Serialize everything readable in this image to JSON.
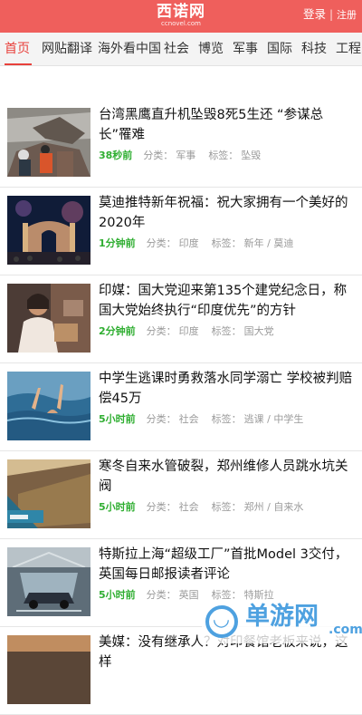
{
  "header": {
    "logo_main": "西诺网",
    "logo_sub": "ccnovel.com",
    "login": "登录",
    "separator": "|",
    "register": "注册"
  },
  "tabs": [
    {
      "label": "首页",
      "active": true
    },
    {
      "label": "网贴翻译",
      "active": false
    },
    {
      "label": "海外看中国",
      "active": false
    },
    {
      "label": "社会",
      "active": false
    },
    {
      "label": "博览",
      "active": false
    },
    {
      "label": "军事",
      "active": false
    },
    {
      "label": "国际",
      "active": false
    },
    {
      "label": "科技",
      "active": false
    },
    {
      "label": "工程",
      "active": false
    }
  ],
  "meta_labels": {
    "category": "分类：",
    "tags": "标签："
  },
  "articles": [
    {
      "title": "台湾黑鹰直升机坠毁8死5生还 “参谋总长”罹难",
      "time": "38秒前",
      "category": "军事",
      "tags": "坠毁",
      "image": "helicopter-crash"
    },
    {
      "title": "莫迪推特新年祝福：祝大家拥有一个美好的2020年",
      "time": "1分钟前",
      "category": "印度",
      "tags": "新年 / 莫迪",
      "image": "fireworks-gate"
    },
    {
      "title": "印媒：国大党迎来第135个建党纪念日，称国大党始终执行“印度优先”的方针",
      "time": "2分钟前",
      "category": "印度",
      "tags": "国大党",
      "image": "woman-portrait"
    },
    {
      "title": "中学生逃课时勇救落水同学溺亡 学校被判赔偿45万",
      "time": "5小时前",
      "category": "社会",
      "tags": "逃课 / 中学生",
      "image": "drowning-hands"
    },
    {
      "title": "寒冬自来水管破裂，郑州维修人员跳水坑关阀",
      "time": "5小时前",
      "category": "社会",
      "tags": "郑州 / 自来水",
      "image": "water-pit"
    },
    {
      "title": "特斯拉上海“超级工厂”首批Model 3交付，英国每日邮报读者评论",
      "time": "5小时前",
      "category": "英国",
      "tags": "特斯拉",
      "image": "tesla-factory"
    },
    {
      "title": "美媒：没有继承人？对印餐馆老板来说，这样",
      "time": "",
      "category": "",
      "tags": "",
      "image": "partial"
    }
  ],
  "watermark": {
    "text": "单游网",
    "domain": ".com",
    "mark": "◡"
  }
}
